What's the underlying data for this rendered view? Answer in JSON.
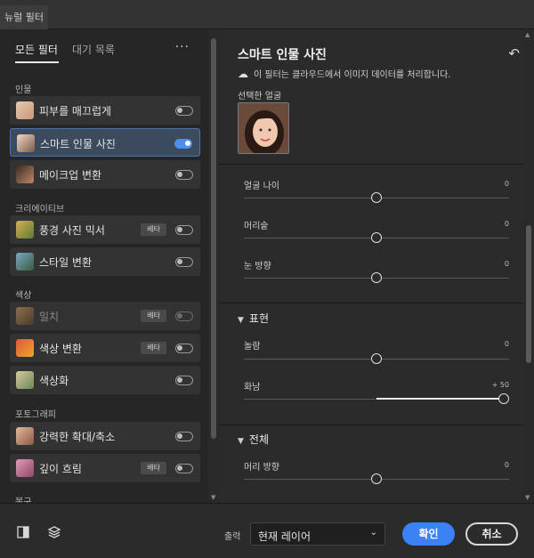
{
  "window": {
    "tab_label": "뉴럴 필터"
  },
  "left": {
    "tabs": [
      "모든 필터",
      "대기 목록"
    ],
    "more": "···",
    "sections": {
      "portrait": "인물",
      "creative": "크리에이티브",
      "color": "색상",
      "photography": "포토그래피",
      "restore": "복구"
    },
    "items": [
      {
        "label": "피부를 매끄럽게",
        "on": false,
        "badge": ""
      },
      {
        "label": "스마트 인물 사진",
        "on": true,
        "badge": ""
      },
      {
        "label": "메이크업 변환",
        "on": false,
        "badge": ""
      },
      {
        "label": "풍경 사진 믹서",
        "on": false,
        "badge": "베타"
      },
      {
        "label": "스타일 변환",
        "on": false,
        "badge": ""
      },
      {
        "label": "일치",
        "on": false,
        "badge": "베타",
        "disabled": true
      },
      {
        "label": "색상 변환",
        "on": false,
        "badge": "베타"
      },
      {
        "label": "색상화",
        "on": false,
        "badge": ""
      },
      {
        "label": "강력한 확대/축소",
        "on": false,
        "badge": ""
      },
      {
        "label": "깊이 흐림",
        "on": false,
        "badge": "베타"
      }
    ]
  },
  "right": {
    "title": "스마트 인물 사진",
    "cloud_note": "이 필터는 클라우드에서 이미지 데이터를 처리합니다.",
    "selected_face_label": "선택한 얼굴",
    "sliders": {
      "face_age": {
        "label": "얼굴 나이",
        "value": "0",
        "level": 0.5
      },
      "hair": {
        "label": "머리숱",
        "value": "0",
        "level": 0.5
      },
      "gaze": {
        "label": "눈 방향",
        "value": "0",
        "level": 0.5
      },
      "surprise": {
        "label": "놀람",
        "value": "0",
        "level": 0.5
      },
      "anger": {
        "label": "화남",
        "value": "+ 50",
        "level": 1.0
      },
      "head_direction": {
        "label": "머리 방향",
        "value": "0",
        "level": 0.5
      }
    },
    "groups": {
      "expression": "표현",
      "global": "전체"
    }
  },
  "bottom": {
    "output_label": "출력",
    "output_value": "현재 레이어",
    "ok_label": "확인",
    "cancel_label": "취소"
  },
  "colors": {
    "accent": "#3b82f6",
    "selected_bg": "#3c4a5e"
  }
}
